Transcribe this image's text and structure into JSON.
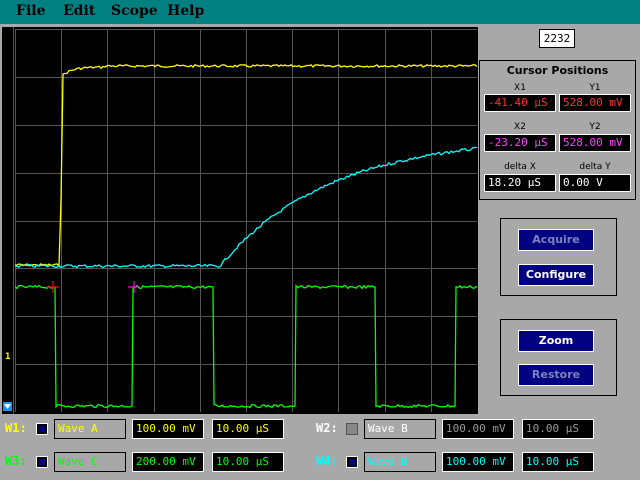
{
  "menu": [
    "File",
    "Edit",
    "Scope",
    "Help"
  ],
  "counter": "2232",
  "cursors": {
    "title": "Cursor Positions",
    "x1_label": "X1",
    "x1_value": "-41.40 µS",
    "y1_label": "Y1",
    "y1_value": "528.00 mV",
    "x2_label": "X2",
    "x2_value": "-23.20 µS",
    "y2_label": "Y2",
    "y2_value": "528.00 mV",
    "dx_label": "delta X",
    "dx_value": "18.20 µS",
    "dy_label": "delta Y",
    "dy_value": "0.00 V"
  },
  "buttons": {
    "acquire": "Acquire",
    "configure": "Configure",
    "zoom": "Zoom",
    "restore": "Restore"
  },
  "scope": {
    "channel_marker": "1"
  },
  "waves": {
    "w1": {
      "label": "W1:",
      "name": "Wave A",
      "volts": "100.00 mV",
      "time": "10.00 µS",
      "enabled": true,
      "color": "#ffff00"
    },
    "w2": {
      "label": "W2:",
      "name": "Wave B",
      "volts": "100.00 mV",
      "time": "10.00 µS",
      "enabled": false,
      "color": "#ffffff"
    },
    "w3": {
      "label": "W3:",
      "name": "Wave C",
      "volts": "200.00 mV",
      "time": "10.00 µS",
      "enabled": true,
      "color": "#00ff00"
    },
    "w4": {
      "label": "W4:",
      "name": "Wave D",
      "volts": "100.00 mV",
      "time": "10.00 µS",
      "enabled": true,
      "color": "#00ffff"
    }
  },
  "colors": {
    "menubar": "#008080",
    "grid": "#555555",
    "trace_yellow": "#ffff00",
    "trace_cyan": "#00ffff",
    "trace_green": "#00ff00",
    "cursor1": "#ff0000",
    "cursor2": "#ff00ff"
  }
}
